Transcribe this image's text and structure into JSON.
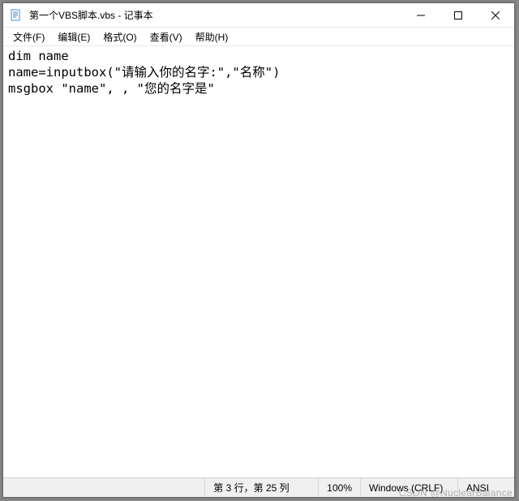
{
  "titlebar": {
    "title": "第一个VBS脚本.vbs - 记事本"
  },
  "menubar": {
    "file": "文件(F)",
    "edit": "编辑(E)",
    "format": "格式(O)",
    "view": "查看(V)",
    "help": "帮助(H)"
  },
  "editor": {
    "content": "dim name\nname=inputbox(\"请输入你的名字:\",\"名称\")\nmsgbox \"name\", , \"您的名字是\""
  },
  "statusbar": {
    "position": "第 3 行，第 25 列",
    "zoom": "100%",
    "lineending": "Windows (CRLF)",
    "encoding": "ANSI"
  },
  "watermark": "CSDN @NuclearBalance"
}
